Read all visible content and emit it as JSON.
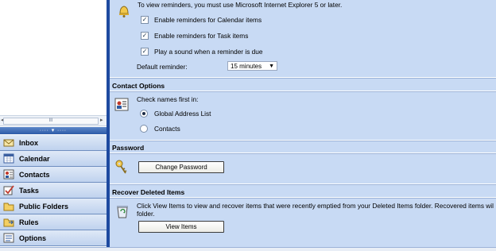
{
  "nav": {
    "scroll_thumb": "III",
    "items": [
      {
        "label": "Inbox",
        "icon": "inbox-icon"
      },
      {
        "label": "Calendar",
        "icon": "calendar-icon"
      },
      {
        "label": "Contacts",
        "icon": "contacts-icon"
      },
      {
        "label": "Tasks",
        "icon": "tasks-icon"
      },
      {
        "label": "Public Folders",
        "icon": "public-folders-icon"
      },
      {
        "label": "Rules",
        "icon": "rules-icon"
      },
      {
        "label": "Options",
        "icon": "options-icon"
      }
    ]
  },
  "reminders": {
    "notice": "To view reminders, you must use Microsoft Internet Explorer 5 or later.",
    "calendar_label": "Enable reminders for Calendar items",
    "calendar_checked": true,
    "task_label": "Enable reminders for Task items",
    "task_checked": true,
    "sound_label": "Play a sound when a reminder is due",
    "sound_checked": true,
    "default_label": "Default reminder:",
    "default_value": "15 minutes"
  },
  "contact_options": {
    "title": "Contact Options",
    "check_label": "Check names first in:",
    "options": [
      "Global Address List",
      "Contacts"
    ],
    "selected": "Global Address List"
  },
  "password": {
    "title": "Password",
    "button": "Change Password"
  },
  "recover": {
    "title": "Recover Deleted Items",
    "description_line1": "Click View Items to view and recover items that were recently emptied from your Deleted Items folder. Recovered items wil",
    "description_line2": "folder.",
    "button": "View Items"
  },
  "colors": {
    "panel_bg": "#c8daf4",
    "nav_accent": "#1e4aa0"
  }
}
